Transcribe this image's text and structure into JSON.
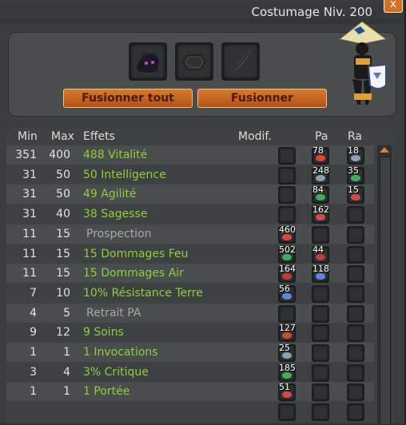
{
  "window": {
    "title": "Costumage Niv. 200",
    "close_label": "x"
  },
  "actions": {
    "merge_all": "Fusionner tout",
    "merge": "Fusionner"
  },
  "slots": [
    {
      "icon": "black-cat-hat-icon"
    },
    {
      "icon": "rune-hexagon-icon"
    },
    {
      "icon": "feather-icon"
    }
  ],
  "columns": {
    "min": "Min",
    "max": "Max",
    "effects": "Effets",
    "modif": "Modif.",
    "pa": "Pa",
    "ra": "Ra"
  },
  "rows": [
    {
      "min": "351",
      "max": "400",
      "effect": "488 Vitalité",
      "active": true,
      "modif": "",
      "pa": "78",
      "ra": "18"
    },
    {
      "min": "31",
      "max": "50",
      "effect": "50 Intelligence",
      "active": true,
      "modif": "",
      "pa": "248",
      "ra": "35"
    },
    {
      "min": "31",
      "max": "50",
      "effect": "49 Agilité",
      "active": true,
      "modif": "",
      "pa": "84",
      "ra": "15"
    },
    {
      "min": "31",
      "max": "40",
      "effect": "38 Sagesse",
      "active": true,
      "modif": "",
      "pa": "162",
      "ra": ""
    },
    {
      "min": "11",
      "max": "15",
      "effect": "Prospection",
      "active": false,
      "modif": "460",
      "pa": "",
      "ra": ""
    },
    {
      "min": "11",
      "max": "15",
      "effect": "15 Dommages Feu",
      "active": true,
      "modif": "502",
      "pa": "44",
      "ra": ""
    },
    {
      "min": "11",
      "max": "15",
      "effect": "15 Dommages Air",
      "active": true,
      "modif": "164",
      "pa": "118",
      "ra": ""
    },
    {
      "min": "7",
      "max": "10",
      "effect": "10% Résistance Terre",
      "active": true,
      "modif": "56",
      "pa": "",
      "ra": ""
    },
    {
      "min": "4",
      "max": "5",
      "effect": "Retrait PA",
      "active": false,
      "modif": "",
      "pa": "",
      "ra": ""
    },
    {
      "min": "9",
      "max": "12",
      "effect": "9 Soins",
      "active": true,
      "modif": "127",
      "pa": "",
      "ra": ""
    },
    {
      "min": "1",
      "max": "1",
      "effect": "1 Invocations",
      "active": true,
      "modif": "25",
      "pa": "",
      "ra": ""
    },
    {
      "min": "3",
      "max": "4",
      "effect": "3% Critique",
      "active": true,
      "modif": "185",
      "pa": "",
      "ra": ""
    },
    {
      "min": "1",
      "max": "1",
      "effect": "1 Portée",
      "active": true,
      "modif": "51",
      "pa": "",
      "ra": ""
    },
    {
      "min": "",
      "max": "",
      "effect": "",
      "active": false,
      "modif": "",
      "pa": "",
      "ra": ""
    }
  ],
  "colors": {
    "accent": "#d5702a",
    "active_text": "#8fcf3c",
    "inactive_text": "#a8a8a8"
  }
}
